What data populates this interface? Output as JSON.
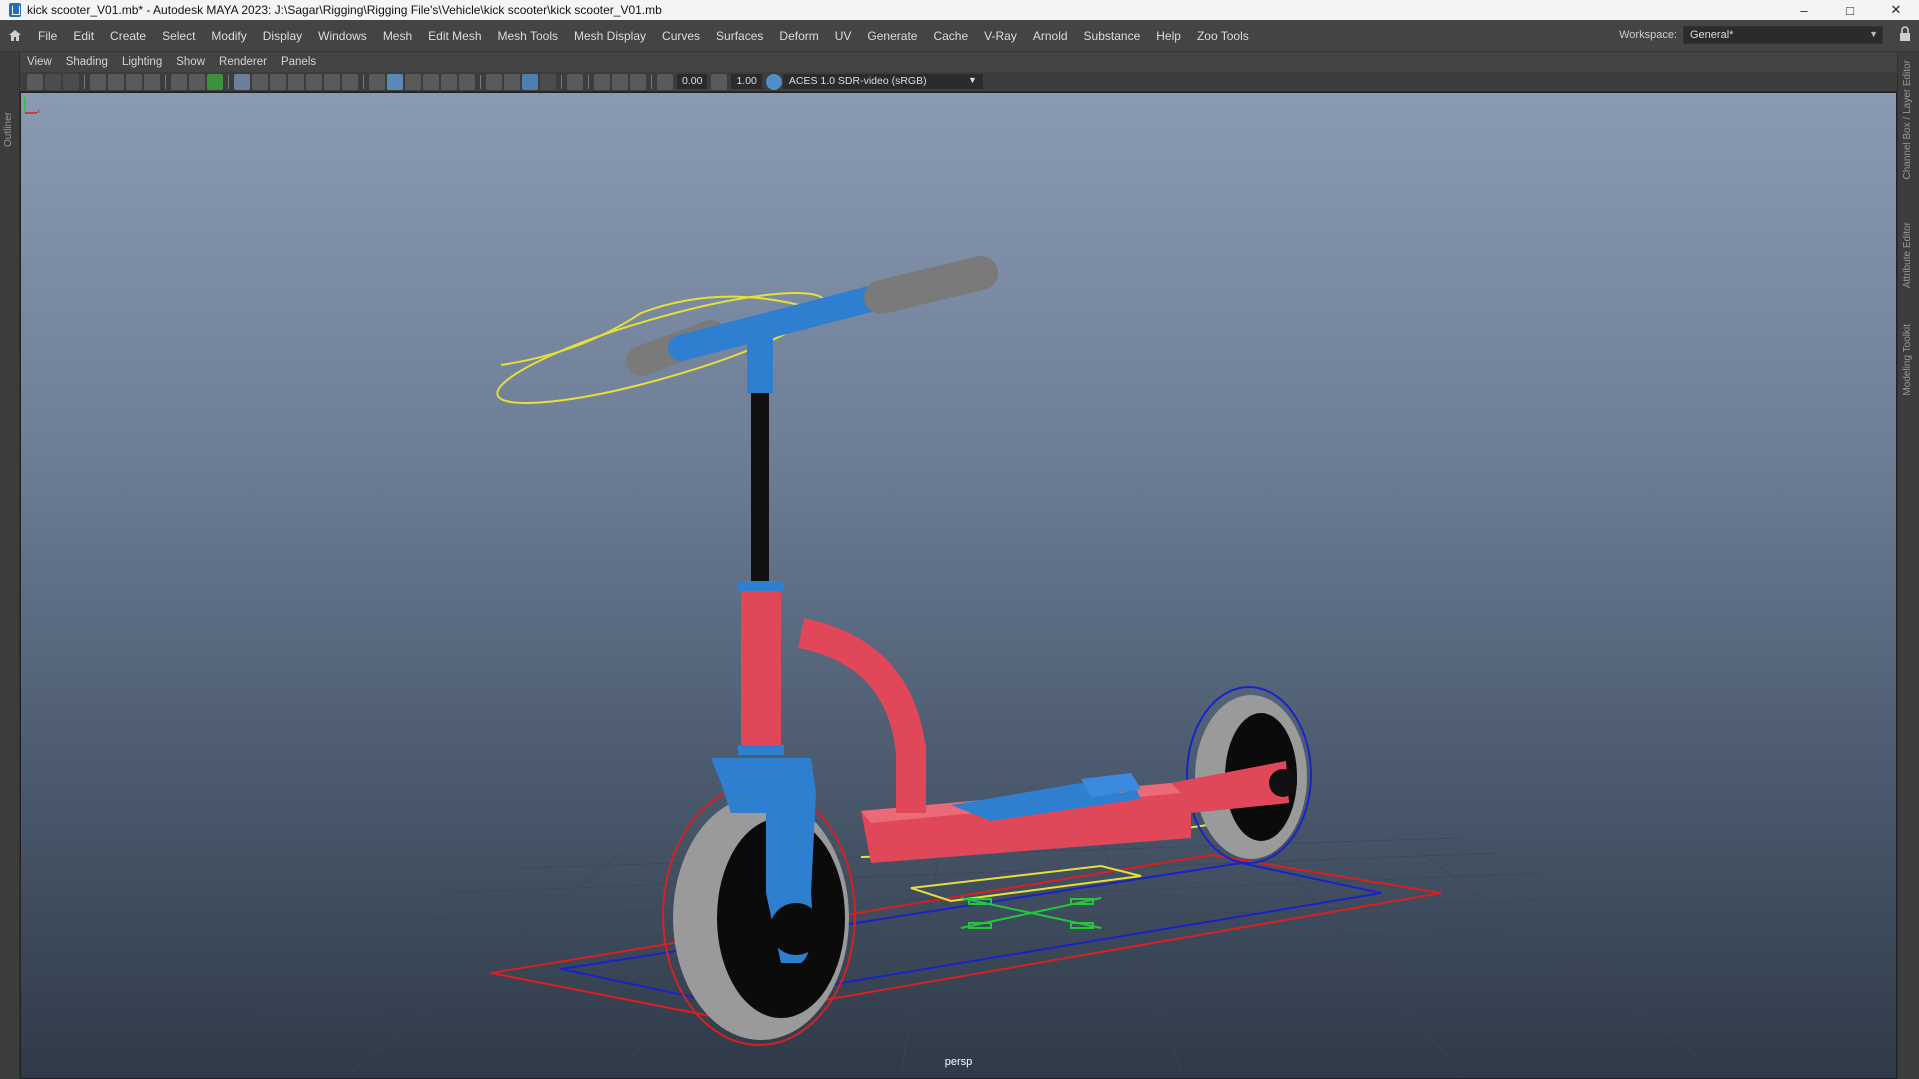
{
  "window": {
    "title": "kick scooter_V01.mb* - Autodesk MAYA 2023: J:\\Sagar\\Rigging\\Rigging File's\\Vehicle\\kick scooter\\kick scooter_V01.mb",
    "controls": [
      "minimize-icon",
      "maximize-icon",
      "close-icon"
    ]
  },
  "menubar": {
    "items": [
      "File",
      "Edit",
      "Create",
      "Select",
      "Modify",
      "Display",
      "Windows",
      "Mesh",
      "Edit Mesh",
      "Mesh Tools",
      "Mesh Display",
      "Curves",
      "Surfaces",
      "Deform",
      "UV",
      "Generate",
      "Cache",
      "V-Ray",
      "Arnold",
      "Substance",
      "Help",
      "Zoo Tools"
    ],
    "workspace_label": "Workspace:",
    "workspace_value": "General*"
  },
  "panel_menu": {
    "items": [
      "View",
      "Shading",
      "Lighting",
      "Show",
      "Renderer",
      "Panels"
    ]
  },
  "panel_toolbar": {
    "exposure": "0.00",
    "gamma": "1.00",
    "color_space": "ACES 1.0 SDR-video (sRGB)"
  },
  "side_panels": {
    "left": "Outliner",
    "right": [
      "Channel Box / Layer Editor",
      "Attribute Editor",
      "Modeling Toolkit"
    ]
  },
  "viewport": {
    "camera": "persp",
    "axis_labels": [
      "y",
      "x"
    ],
    "colors": {
      "body_red": "#e0485a",
      "accent_blue": "#2f7fd0",
      "tire_gray": "#9a9a9a",
      "control_yellow": "#e6df3a",
      "control_red": "#d82020",
      "control_blue": "#1a23c8",
      "control_green": "#22c83a"
    }
  }
}
